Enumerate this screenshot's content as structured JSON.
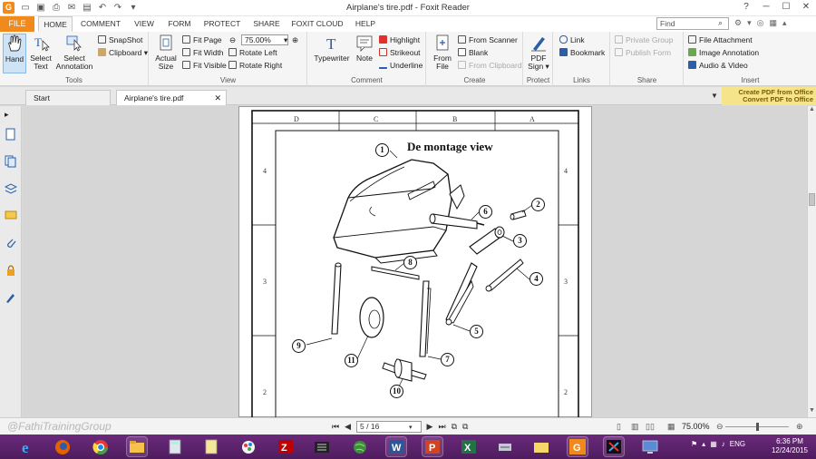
{
  "app": {
    "title": "Airplane's tire.pdf - Foxit Reader",
    "logo_letter": "G"
  },
  "ribbon_tabs": [
    "FILE",
    "HOME",
    "COMMENT",
    "VIEW",
    "FORM",
    "PROTECT",
    "SHARE",
    "FOXIT CLOUD",
    "HELP"
  ],
  "search": {
    "placeholder": "Find"
  },
  "ribbon": {
    "tools": {
      "label": "Tools",
      "hand": "Hand",
      "select_text": [
        "Select",
        "Text"
      ],
      "select_annotation": [
        "Select",
        "Annotation"
      ],
      "snapshot": "SnapShot",
      "clipboard": "Clipboard"
    },
    "view": {
      "label": "View",
      "actual_size": [
        "Actual",
        "Size"
      ],
      "fit_page": "Fit Page",
      "fit_width": "Fit Width",
      "fit_visible": "Fit Visible",
      "zoom": "75.00%",
      "rotate_left": "Rotate Left",
      "rotate_right": "Rotate Right"
    },
    "comment": {
      "label": "Comment",
      "typewriter": "Typewriter",
      "note": "Note",
      "highlight": "Highlight",
      "strikeout": "Strikeout",
      "underline": "Underline"
    },
    "create": {
      "label": "Create",
      "from_file": [
        "From",
        "File"
      ],
      "from_scanner": "From Scanner",
      "blank": "Blank",
      "from_clipboard": "From Clipboard"
    },
    "protect": {
      "label": "Protect",
      "pdf_sign": [
        "PDF",
        "Sign"
      ]
    },
    "links": {
      "label": "Links",
      "link": "Link",
      "bookmark": "Bookmark"
    },
    "share": {
      "label": "Share",
      "private_group": "Private Group",
      "publish_form": "Publish Form"
    },
    "insert": {
      "label": "Insert",
      "file_attachment": "File Attachment",
      "image_annotation": "Image Annotation",
      "audio_video": "Audio & Video"
    }
  },
  "doc_tabs": [
    {
      "label": "Start"
    },
    {
      "label": "Airplane's tire.pdf"
    }
  ],
  "promo": [
    "Create PDF from Office",
    "Convert PDF to Office"
  ],
  "drawing": {
    "title": "De montage view",
    "zones_top": [
      "D",
      "C",
      "B",
      "A"
    ],
    "zones_side": [
      "4",
      "3",
      "2"
    ],
    "parts": [
      "1",
      "2",
      "3",
      "4",
      "5",
      "6",
      "7",
      "8",
      "9",
      "10",
      "11"
    ]
  },
  "status": {
    "watermark": "@FathiTrainingGroup",
    "page_display": "5 / 16",
    "zoom": "75.00%"
  },
  "taskbar": {
    "language": "ENG",
    "time": "6:36 PM",
    "date": "12/24/2015",
    "apps": [
      "ie-icon",
      "firefox-icon",
      "chrome-icon",
      "explorer-icon",
      "calculator-icon",
      "notepad-icon",
      "paint-icon",
      "filezilla-icon",
      "media-icon",
      "globe-icon",
      "word-icon",
      "powerpoint-icon",
      "excel-icon",
      "network-icon",
      "folder-icon",
      "foxit-icon",
      "camtasia-icon",
      "screen-icon"
    ],
    "colors": {
      "taskbar": "#5a2268",
      "accent": "#f08a1c"
    }
  }
}
